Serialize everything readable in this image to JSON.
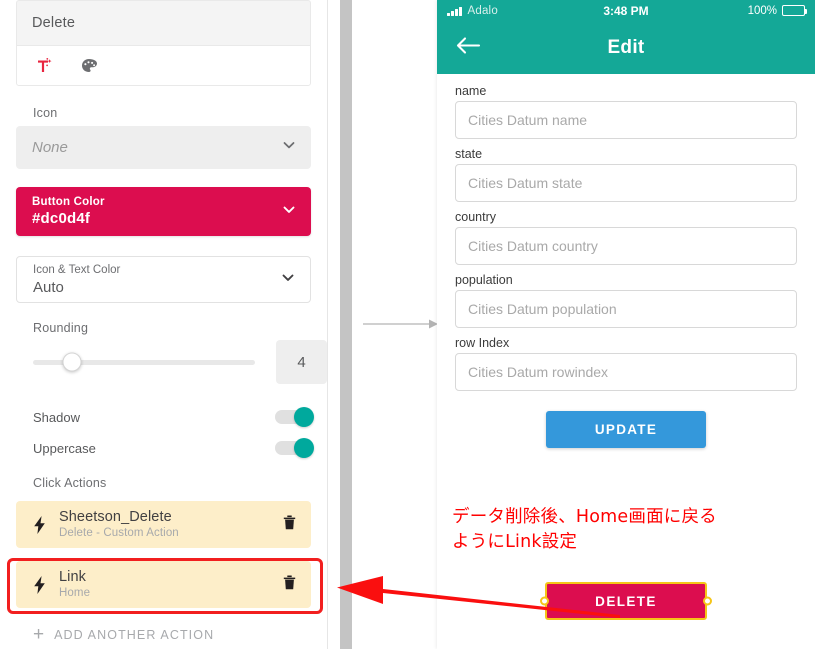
{
  "left_panel": {
    "label_field": {
      "value": "Delete"
    },
    "style_tools": [
      {
        "name": "text-style-icon",
        "title": "Text Style"
      },
      {
        "name": "palette-icon",
        "title": "Color Palette"
      }
    ],
    "icon_section": {
      "label": "Icon",
      "selected": "None"
    },
    "button_color": {
      "title": "Button Color",
      "value": "#dc0d4f",
      "swatch_hex": "#dc0d4f"
    },
    "icon_text_color": {
      "title": "Icon & Text Color",
      "value": "Auto"
    },
    "rounding": {
      "label": "Rounding",
      "value": "4",
      "slider_percent": 18
    },
    "toggles": [
      {
        "label": "Shadow",
        "on": true
      },
      {
        "label": "Uppercase",
        "on": true
      }
    ],
    "click_actions": {
      "label": "Click Actions",
      "items": [
        {
          "title": "Sheetson_Delete",
          "subtitle": "Delete - Custom Action",
          "highlighted": false
        },
        {
          "title": "Link",
          "subtitle": "Home",
          "highlighted": true
        }
      ],
      "add_label": "ADD ANOTHER ACTION"
    },
    "highlight_color": "#f21f1f"
  },
  "phone": {
    "status_bar": {
      "carrier": "Adalo",
      "time": "3:48 PM",
      "battery": "100%"
    },
    "nav": {
      "title": "Edit",
      "back_icon": "arrow-left-icon",
      "bar_color": "#14a897"
    },
    "form": {
      "fields": [
        {
          "label": "name",
          "placeholder": "Cities Datum name"
        },
        {
          "label": "state",
          "placeholder": "Cities Datum state"
        },
        {
          "label": "country",
          "placeholder": "Cities Datum country"
        },
        {
          "label": "population",
          "placeholder": "Cities Datum population"
        },
        {
          "label": "row Index",
          "placeholder": "Cities Datum rowindex"
        }
      ],
      "update_button": "UPDATE",
      "update_color": "#3498db"
    },
    "annotation": "データ削除後、Home画面に戻る\nようにLink設定",
    "delete_button": {
      "label": "DELETE",
      "fill": "#dc0d4f",
      "selection_color": "#f5c518"
    }
  }
}
